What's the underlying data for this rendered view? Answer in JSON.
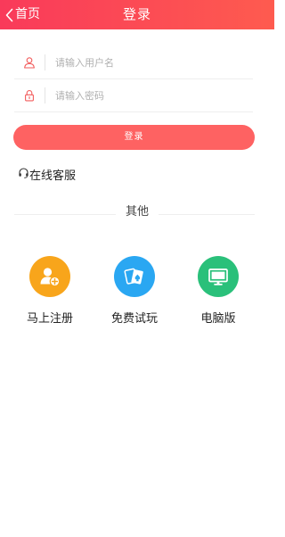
{
  "header": {
    "back_label": "首页",
    "title": "登录"
  },
  "form": {
    "username_placeholder": "请输入用户名",
    "password_placeholder": "请输入密码",
    "username_value": "",
    "password_value": "",
    "login_label": "登录"
  },
  "service": {
    "label": "在线客服",
    "icon": "headset-icon"
  },
  "other": {
    "label": "其他",
    "items": [
      {
        "label": "马上注册",
        "icon": "add-user-icon",
        "color": "#f8a51b"
      },
      {
        "label": "免费试玩",
        "icon": "playing-cards-icon",
        "color": "#2aa7f2"
      },
      {
        "label": "电脑版",
        "icon": "monitor-icon",
        "color": "#2ac07a"
      }
    ]
  },
  "colors": {
    "header_gradient_start": "#f93a5a",
    "header_gradient_end": "#fe5b4f",
    "login_button": "#fe6262",
    "field_icon": "#f25b5b"
  }
}
